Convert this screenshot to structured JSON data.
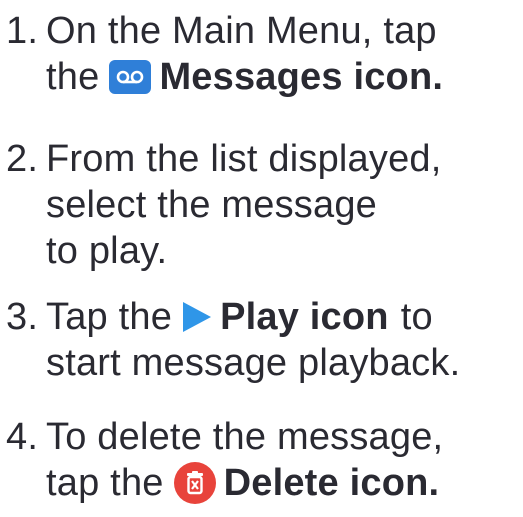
{
  "steps": [
    {
      "number": "1.",
      "line1": "On the Main Menu, tap",
      "line2_pre": "the",
      "icon": "voicemail-icon",
      "line2_bold": "Messages icon."
    },
    {
      "number": "2.",
      "line1": "From the list displayed,",
      "line2": "select the message",
      "line3": "to play."
    },
    {
      "number": "3.",
      "line1_pre": "Tap the",
      "icon": "play-icon",
      "line1_bold": "Play icon",
      "line1_post": "to",
      "line2": "start message playback."
    },
    {
      "number": "4.",
      "line1": "To delete the message,",
      "line2_pre": "tap the",
      "icon": "delete-icon",
      "line2_bold": "Delete icon."
    }
  ],
  "colors": {
    "text": "#2a2a32",
    "voicemail_icon_bg": "#2f7fd8",
    "play_icon": "#2f96e8",
    "delete_icon_bg": "#e8433b"
  }
}
